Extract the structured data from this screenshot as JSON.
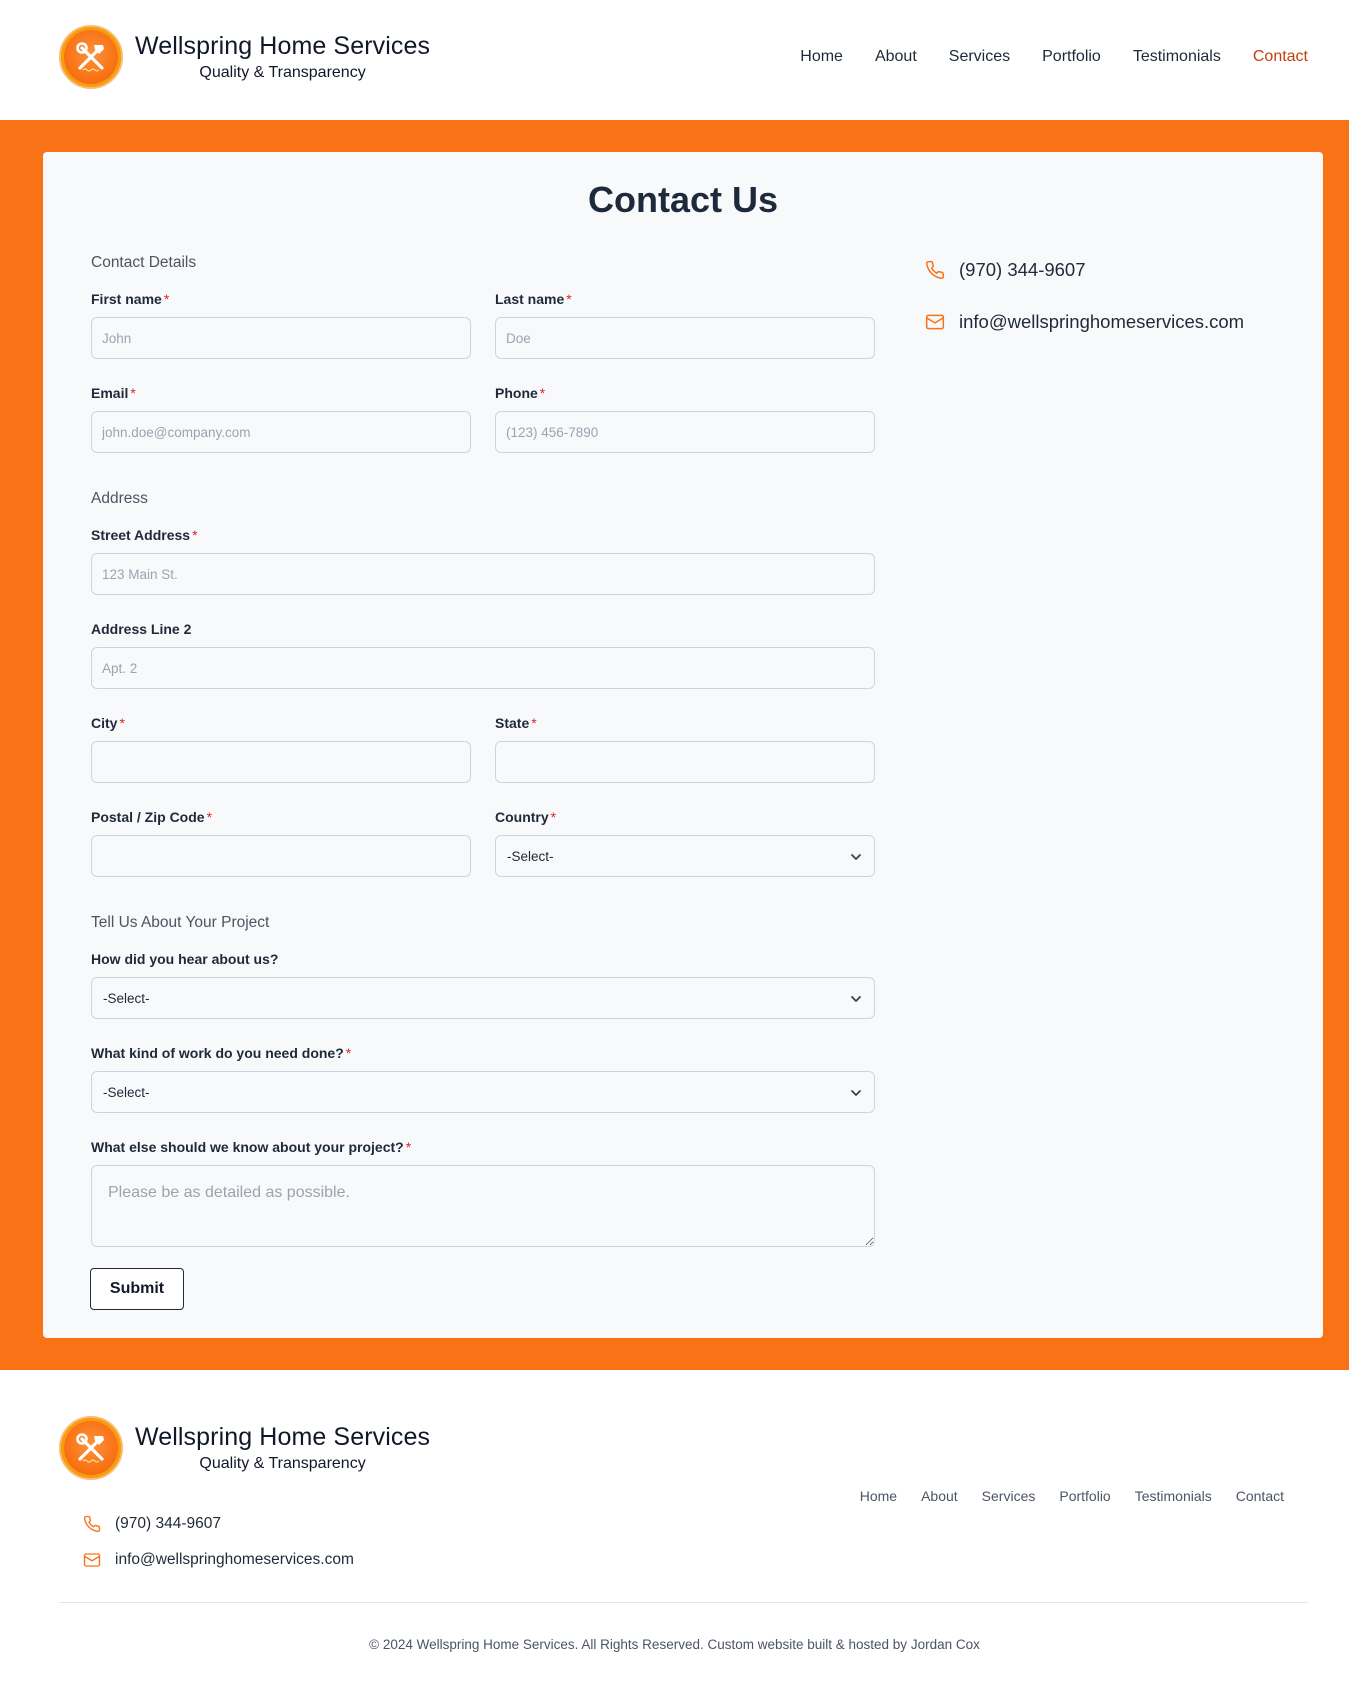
{
  "brand": {
    "name": "Wellspring Home Services",
    "tagline": "Quality & Transparency"
  },
  "nav": {
    "items": [
      {
        "label": "Home"
      },
      {
        "label": "About"
      },
      {
        "label": "Services"
      },
      {
        "label": "Portfolio"
      },
      {
        "label": "Testimonials"
      },
      {
        "label": "Contact",
        "active": true
      }
    ]
  },
  "colors": {
    "accent": "#f97316",
    "active_link": "#c2410c",
    "required": "#dc2626"
  },
  "page": {
    "title": "Contact Us"
  },
  "form": {
    "contact_details_label": "Contact Details",
    "first_name": {
      "label": "First name",
      "required": "*",
      "placeholder": "John"
    },
    "last_name": {
      "label": "Last name",
      "required": "*",
      "placeholder": "Doe"
    },
    "email": {
      "label": "Email",
      "required": "*",
      "placeholder": "john.doe@company.com"
    },
    "phone": {
      "label": "Phone",
      "required": "*",
      "placeholder": "(123) 456-7890"
    },
    "address_label": "Address",
    "street": {
      "label": "Street Address",
      "required": "*",
      "placeholder": "123 Main St."
    },
    "address2": {
      "label": "Address Line 2",
      "placeholder": "Apt. 2"
    },
    "city": {
      "label": "City",
      "required": "*"
    },
    "state": {
      "label": "State",
      "required": "*"
    },
    "zip": {
      "label": "Postal / Zip Code",
      "required": "*"
    },
    "country": {
      "label": "Country",
      "required": "*",
      "value": "-Select-"
    },
    "project_label": "Tell Us About Your Project",
    "hear": {
      "label": "How did you hear about us?",
      "value": "-Select-"
    },
    "work": {
      "label": "What kind of work do you need done?",
      "required": "*",
      "value": "-Select-"
    },
    "details": {
      "label": "What else should we know about your project?",
      "required": "*",
      "placeholder": "Please be as detailed as possible."
    },
    "submit_label": "Submit"
  },
  "contact": {
    "phone": "(970) 344-9607",
    "email": "info@wellspringhomeservices.com",
    "phone_icon": "phone-icon",
    "email_icon": "mail-icon"
  },
  "footer": {
    "copyright": "© 2024 Wellspring Home Services. All Rights Reserved. Custom website built & hosted by Jordan Cox"
  }
}
